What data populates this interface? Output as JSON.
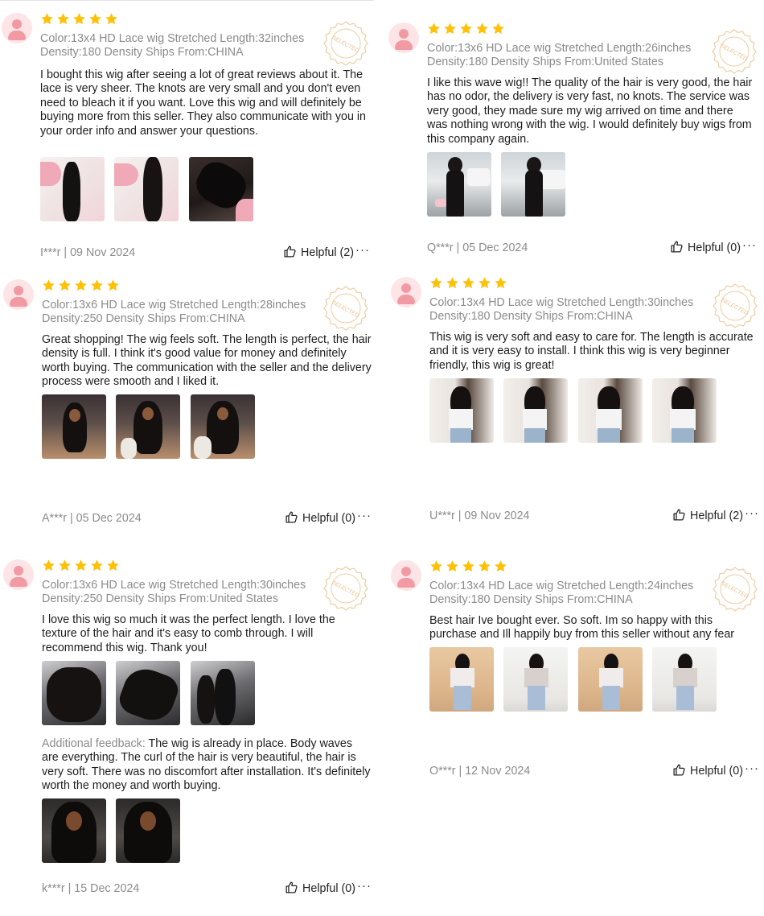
{
  "colors": {
    "star": "#FFC107",
    "meta_text": "#8B8B8B",
    "avatar_bg": "#FDE4E6",
    "avatar_fg": "#F29AA3",
    "seal": "#E9C08C"
  },
  "icons": {
    "avatar": "user-avatar-icon",
    "rating": "star-icon",
    "badge": "selected-seal-icon",
    "helpful": "thumbs-up-icon",
    "more": "more-dots-icon"
  },
  "badge_text": "SELECTED",
  "reviews": [
    {
      "rating": 5,
      "meta_line1": "Color:13x4 HD Lace wig Stretched Length:32inches",
      "meta_line2": "Density:180 Density Ships From:CHINA",
      "text": "I bought this wig after seeing a lot of great reviews about it. The lace is very sheer. The knots are very small and you don't even need to bleach it if you want. Love this wig and will definitely be buying more from this seller. They also communicate with you in your order info and answer your questions.",
      "photos": [
        "wig-bundle-photo",
        "wig-bundle-photo",
        "wig-bundle-photo"
      ],
      "author": "I***r | 09 Nov 2024",
      "helpful": "Helpful (2)"
    },
    {
      "rating": 5,
      "meta_line1": "Color:13x6 HD Lace wig Stretched Length:26inches",
      "meta_line2": "Density:180 Density Ships From:United States",
      "text": "I like this wave wig!! The quality of the hair is very good, the hair has no odor, the delivery is very fast, no knots. The service was very good, they made sure my wig arrived on time and there was nothing wrong with the wig. I would definitely buy wigs from this company again.",
      "photos": [
        "customer-photo",
        "customer-photo"
      ],
      "author": "Q***r | 05 Dec 2024",
      "helpful": "Helpful (0)"
    },
    {
      "rating": 5,
      "meta_line1": "Color:13x6 HD Lace wig Stretched Length:28inches",
      "meta_line2": "Density:250 Density Ships From:CHINA",
      "text": "Great shopping! The wig feels soft. The length is perfect, the hair density is full. I think it's good value for money and definitely worth buying. The communication with the seller and the delivery process were smooth and I liked it.",
      "photos": [
        "customer-photo",
        "customer-photo",
        "customer-photo"
      ],
      "author": "A***r | 05 Dec 2024",
      "helpful": "Helpful (0)"
    },
    {
      "rating": 5,
      "meta_line1": "Color:13x4 HD Lace wig Stretched Length:30inches",
      "meta_line2": "Density:180 Density Ships From:CHINA",
      "text": "This wig is very soft and easy to care for. The length is accurate and it is very easy to install. I think this wig is very beginner friendly, this wig is great!",
      "photos": [
        "customer-photo",
        "customer-photo",
        "customer-photo",
        "customer-photo"
      ],
      "author": "U***r | 09 Nov 2024",
      "helpful": "Helpful (2)"
    },
    {
      "rating": 5,
      "meta_line1": "Color:13x6 HD Lace wig Stretched Length:30inches",
      "meta_line2": "Density:250 Density Ships From:United States",
      "text": "I love this wig so much it was the perfect length. I love the texture of the hair and it's easy to comb through. I will recommend this wig. Thank you!",
      "photos": [
        "wig-bundle-photo",
        "wig-bundle-photo",
        "wig-bundle-photo"
      ],
      "additional_label": "Additional feedback:",
      "additional_text": " The wig is already in place. Body waves are everything. The curl of the hair is very beautiful, the hair is very soft. There was no discomfort after installation. It's definitely worth the money and worth buying.",
      "additional_photos": [
        "customer-photo",
        "customer-photo"
      ],
      "author": "k***r | 15 Dec 2024",
      "helpful": "Helpful (0)"
    },
    {
      "rating": 5,
      "meta_line1": "Color:13x4 HD Lace wig Stretched Length:24inches",
      "meta_line2": "Density:180 Density Ships From:CHINA",
      "text": "Best hair Ive bought ever. So soft. Im so happy with this purchase and Ill happily buy from this seller without any fear",
      "photos": [
        "customer-photo",
        "customer-photo",
        "customer-photo",
        "customer-photo"
      ],
      "author": "O***r | 12 Nov 2024",
      "helpful": "Helpful (0)"
    }
  ]
}
